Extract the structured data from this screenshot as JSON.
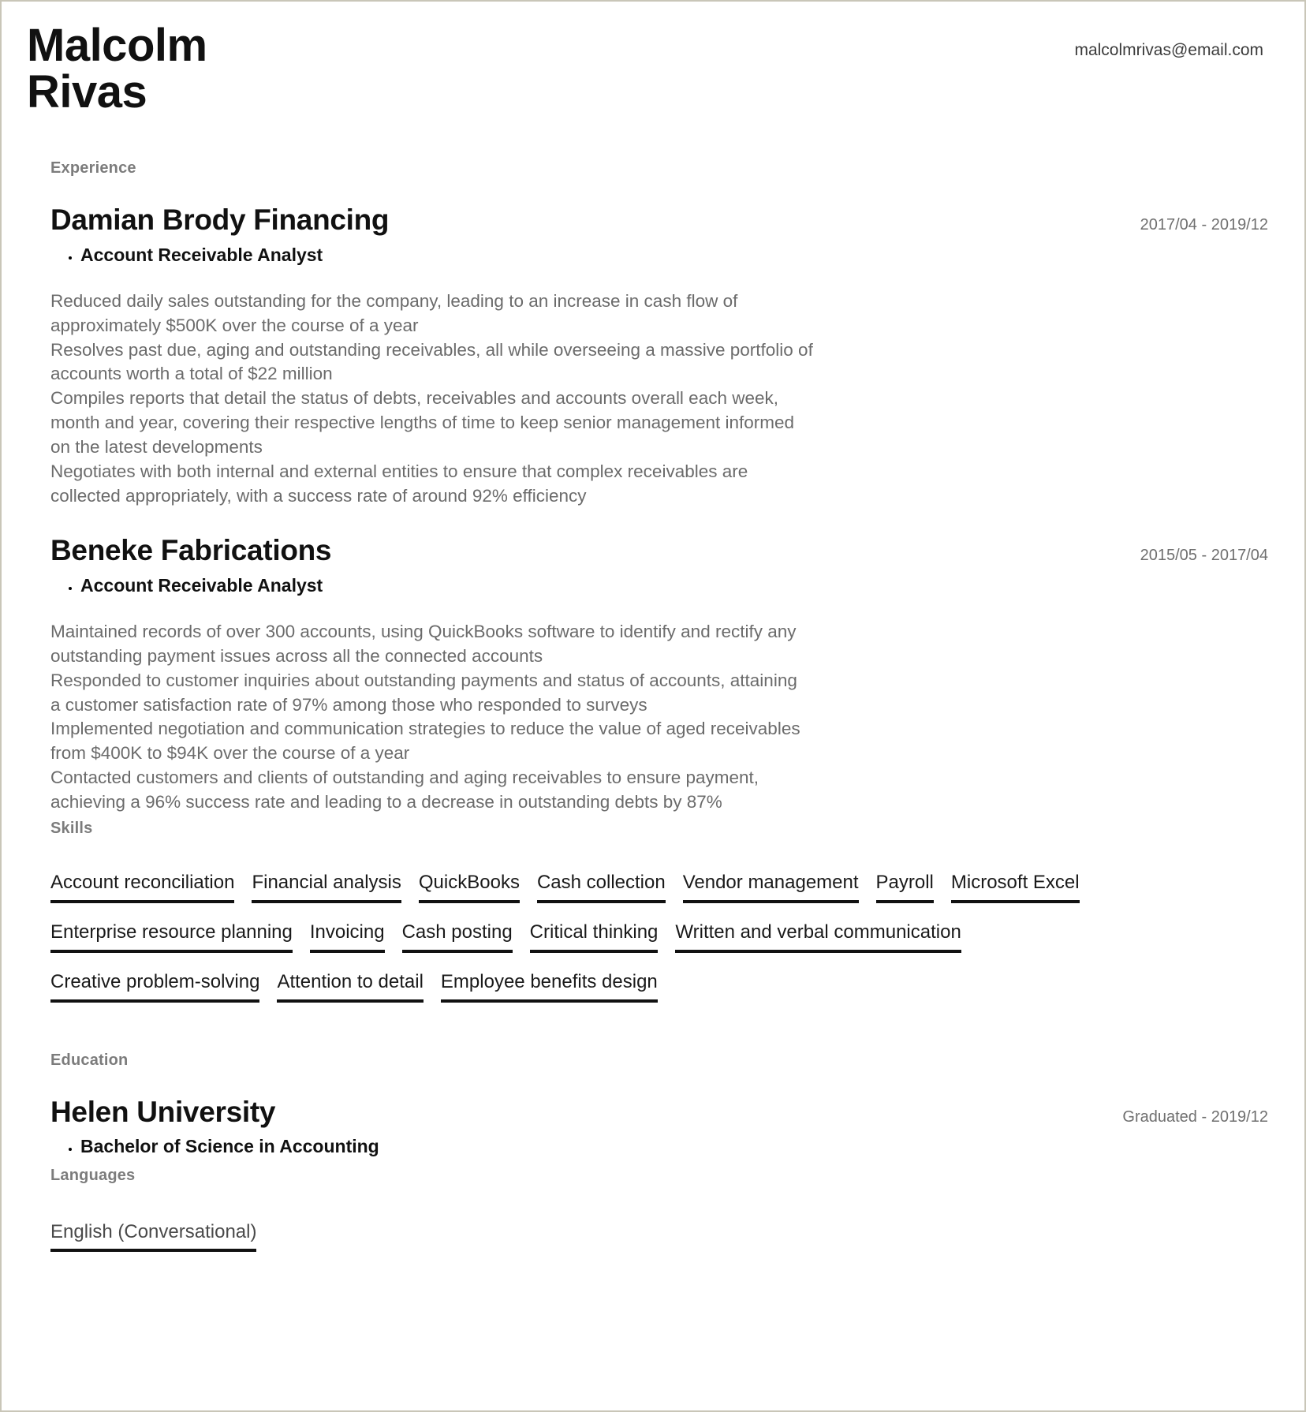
{
  "document": {
    "type": "resume",
    "accent_color": "#111111",
    "muted_color": "#7c7c7c",
    "body_color": "#6b6b6b"
  },
  "header": {
    "name": "Malcolm\nRivas",
    "email": "malcolmrivas@email.com"
  },
  "experience": {
    "label": "Experience",
    "entries": [
      {
        "organization": "Damian Brody Financing",
        "date": "2017/04 - 2019/12",
        "role": "Account Receivable Analyst",
        "description": [
          "Reduced daily sales outstanding for the company, leading to an increase in cash flow of",
          "approximately $500K over the course of a year",
          "Resolves past due, aging and outstanding receivables, all while overseeing a massive portfolio of",
          "accounts worth a total of $22 million",
          "Compiles reports that detail the status of debts, receivables and accounts overall each week,",
          "month and year, covering their respective lengths of time to keep senior management informed",
          "on the latest developments",
          "Negotiates with both internal and external entities to ensure that complex receivables are",
          "collected appropriately, with a success rate of around 92% efficiency"
        ]
      },
      {
        "organization": "Beneke Fabrications",
        "date": "2015/05 - 2017/04",
        "role": "Account Receivable Analyst",
        "description": [
          "Maintained records of over 300 accounts, using QuickBooks software to identify and rectify any",
          "outstanding payment issues across all the connected accounts",
          "Responded to customer inquiries about outstanding payments and status of accounts, attaining",
          "a customer satisfaction rate of 97% among those who responded to surveys",
          "Implemented negotiation and communication strategies to reduce the value of aged receivables",
          "from $400K to $94K over the course of a year",
          "Contacted customers and clients of outstanding and aging receivables to ensure payment,",
          "achieving a 96% success rate and leading to a decrease in outstanding debts by 87%"
        ]
      }
    ]
  },
  "skills": {
    "label": "Skills",
    "items": [
      "Account reconciliation",
      "Financial analysis",
      "QuickBooks",
      "Cash collection",
      "Vendor management",
      "Payroll",
      "Microsoft Excel",
      "Enterprise resource planning",
      "Invoicing",
      "Cash posting",
      "Critical thinking",
      "Written and verbal communication",
      "Creative problem-solving",
      "Attention to detail",
      "Employee benefits design"
    ]
  },
  "education": {
    "label": "Education",
    "entries": [
      {
        "organization": "Helen University",
        "date": "Graduated - 2019/12",
        "role": "Bachelor of Science in Accounting"
      }
    ]
  },
  "languages": {
    "label": "Languages",
    "items": [
      "English  (Conversational)"
    ]
  }
}
